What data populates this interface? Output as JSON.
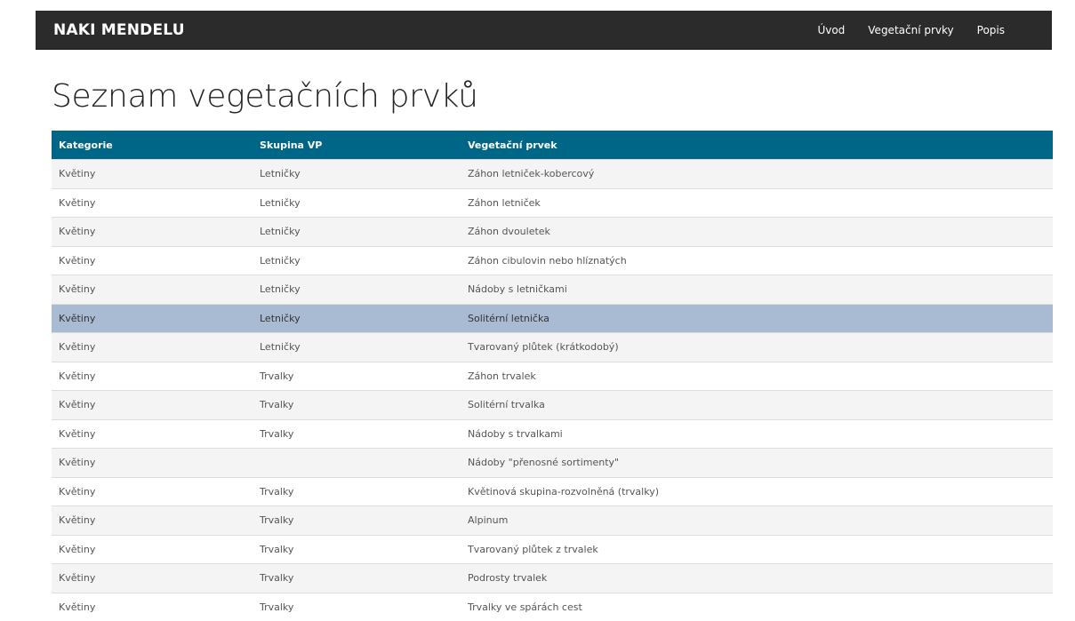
{
  "navbar": {
    "brand": "NAKI MENDELU",
    "links": [
      "Úvod",
      "Vegetační prvky",
      "Popis"
    ]
  },
  "page": {
    "title": "Seznam vegetačních prvků"
  },
  "table": {
    "headers": [
      "Kategorie",
      "Skupina VP",
      "Vegetační prvek"
    ],
    "selected_row_index": 5,
    "rows": [
      [
        "Květiny",
        "Letničky",
        "Záhon letniček-kobercový"
      ],
      [
        "Květiny",
        "Letničky",
        "Záhon letniček"
      ],
      [
        "Květiny",
        "Letničky",
        "Záhon dvouletek"
      ],
      [
        "Květiny",
        "Letničky",
        "Záhon cibulovin nebo hlíznatých"
      ],
      [
        "Květiny",
        "Letničky",
        "Nádoby s letničkami"
      ],
      [
        "Květiny",
        "Letničky",
        "Solitérní letnička"
      ],
      [
        "Květiny",
        "Letničky",
        "Tvarovaný plůtek (krátkodobý)"
      ],
      [
        "Květiny",
        "Trvalky",
        "Záhon trvalek"
      ],
      [
        "Květiny",
        "Trvalky",
        "Solitérní trvalka"
      ],
      [
        "Květiny",
        "Trvalky",
        "Nádoby s trvalkami"
      ],
      [
        "Květiny",
        "",
        "Nádoby \"přenosné sortimenty\""
      ],
      [
        "Květiny",
        "Trvalky",
        "Květinová skupina-rozvolněná (trvalky)"
      ],
      [
        "Květiny",
        "Trvalky",
        "Alpinum"
      ],
      [
        "Květiny",
        "Trvalky",
        "Tvarovaný plůtek z trvalek"
      ],
      [
        "Květiny",
        "Trvalky",
        "Podrosty trvalek"
      ],
      [
        "Květiny",
        "Trvalky",
        "Trvalky ve spárách cest"
      ]
    ]
  },
  "colors": {
    "navbar_bg": "#2b2b2b",
    "table_header_bg": "#006687",
    "selected_row_bg": "#a8bbd3"
  }
}
